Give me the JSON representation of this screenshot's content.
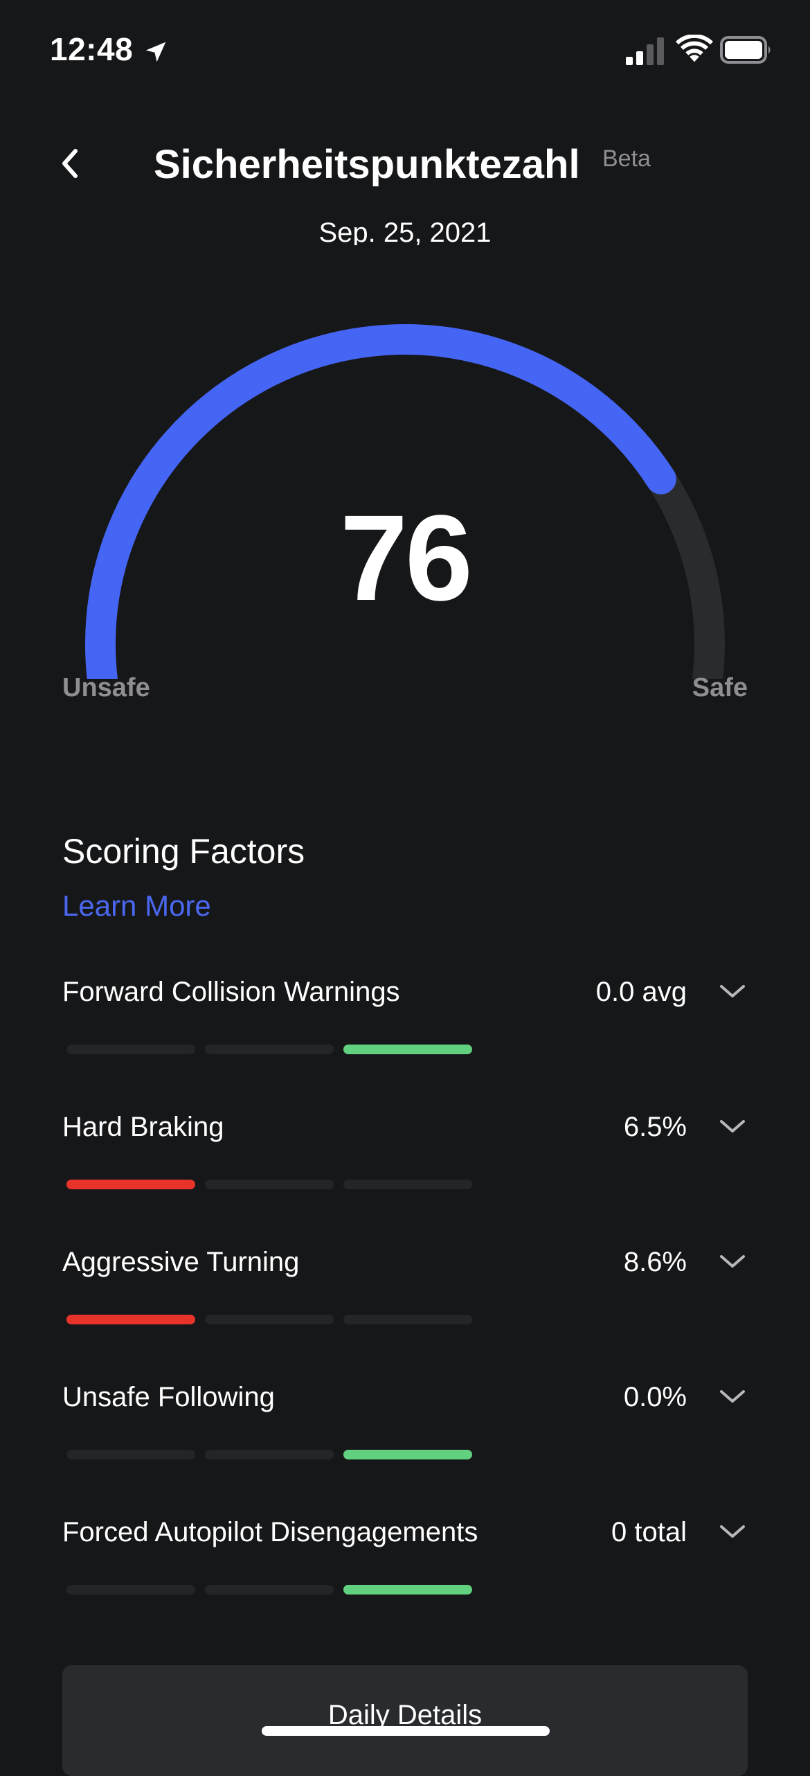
{
  "status_bar": {
    "time": "12:48",
    "icons": [
      "location-arrow-icon",
      "cellular-signal-icon",
      "wifi-icon",
      "battery-icon"
    ]
  },
  "header": {
    "title": "Sicherheitspunktezahl",
    "badge": "Beta",
    "back_icon": "chevron-left-icon"
  },
  "date": "Sep. 25, 2021",
  "gauge": {
    "score": "76",
    "score_fraction": 0.76,
    "min_label": "Unsafe",
    "max_label": "Safe",
    "colors": {
      "fill": "#4565f5",
      "track": "#2a2b2d"
    }
  },
  "scoring_factors": {
    "title": "Scoring Factors",
    "learn_more": "Learn More",
    "items": [
      {
        "name": "Forward Collision Warnings",
        "value": "0.0 avg",
        "active_segment": 2,
        "color": "#62d17f"
      },
      {
        "name": "Hard Braking",
        "value": "6.5%",
        "active_segment": 0,
        "color": "#e8332a"
      },
      {
        "name": "Aggressive Turning",
        "value": "8.6%",
        "active_segment": 0,
        "color": "#e8332a"
      },
      {
        "name": "Unsafe Following",
        "value": "0.0%",
        "active_segment": 2,
        "color": "#62d17f"
      },
      {
        "name": "Forced Autopilot Disengagements",
        "value": "0 total",
        "active_segment": 2,
        "color": "#62d17f"
      }
    ]
  },
  "daily_details": {
    "label": "Daily Details"
  },
  "colors": {
    "background": "#161719",
    "accent": "#4a68f0",
    "muted": "#8e8e93"
  }
}
